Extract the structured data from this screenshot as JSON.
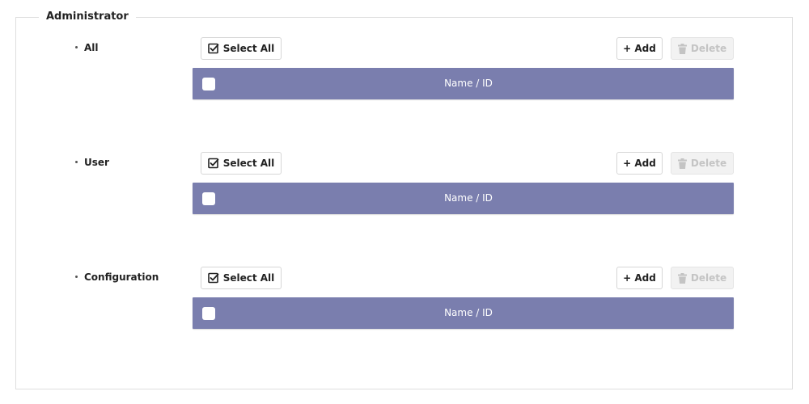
{
  "panel": {
    "title": "Administrator"
  },
  "sections": [
    {
      "label": "All",
      "select_all_label": "Select All",
      "add_label": "+ Add",
      "delete_label": "Delete",
      "column_header": "Name / ID"
    },
    {
      "label": "User",
      "select_all_label": "Select All",
      "add_label": "+ Add",
      "delete_label": "Delete",
      "column_header": "Name / ID"
    },
    {
      "label": "Configuration",
      "select_all_label": "Select All",
      "add_label": "+ Add",
      "delete_label": "Delete",
      "column_header": "Name / ID"
    }
  ],
  "colors": {
    "table_header_bg": "#7a7eae",
    "disabled_text": "#c4c4c4"
  },
  "icons": {
    "select_all": "checkbox-check-icon",
    "delete": "trash-icon"
  }
}
